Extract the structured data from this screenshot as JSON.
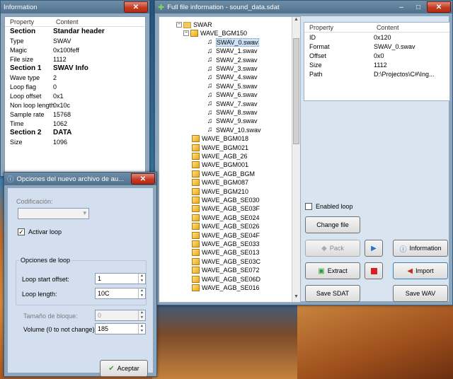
{
  "info_window": {
    "title": "Information",
    "close_icon": "close-icon",
    "columns": [
      "Property",
      "Content"
    ],
    "rows": [
      {
        "k": "Section",
        "v": "Standar header",
        "section": true
      },
      {
        "k": "Type",
        "v": "SWAV"
      },
      {
        "k": "Magic",
        "v": "0x100feff"
      },
      {
        "k": "File size",
        "v": "1112"
      },
      {
        "k": "Section 1",
        "v": "SWAV Info",
        "section": true
      },
      {
        "k": "Wave type",
        "v": "2"
      },
      {
        "k": "Loop flag",
        "v": "0"
      },
      {
        "k": "Loop offset",
        "v": "0x1"
      },
      {
        "k": "Non loop length",
        "v": "0x10c"
      },
      {
        "k": "Sample rate",
        "v": "15768"
      },
      {
        "k": "Time",
        "v": "1062"
      },
      {
        "k": "Section 2",
        "v": "DATA",
        "section": true
      },
      {
        "k": "Size",
        "v": "1096"
      }
    ]
  },
  "main_window": {
    "title": "Full file information - sound_data.sdat",
    "minimize": "–",
    "maximize": "□",
    "close": "✕",
    "tree": {
      "root": "SWAR",
      "expanded": "WAVE_BGM150",
      "children": [
        "SWAV_0.swav",
        "SWAV_1.swav",
        "SWAV_2.swav",
        "SWAV_3.swav",
        "SWAV_4.swav",
        "SWAV_5.swav",
        "SWAV_6.swav",
        "SWAV_7.swav",
        "SWAV_8.swav",
        "SWAV_9.swav",
        "SWAV_10.swav"
      ],
      "selected": "SWAV_0.swav",
      "siblings": [
        "WAVE_BGM018",
        "WAVE_BGM021",
        "WAVE_AGB_26",
        "WAVE_BGM001",
        "WAVE_AGB_BGM",
        "WAVE_BGM087",
        "WAVE_BGM210",
        "WAVE_AGB_SE030",
        "WAVE_AGB_SE03F",
        "WAVE_AGB_SE024",
        "WAVE_AGB_SE026",
        "WAVE_AGB_SE04F",
        "WAVE_AGB_SE033",
        "WAVE_AGB_SE013",
        "WAVE_AGB_SE03C",
        "WAVE_AGB_SE072",
        "WAVE_AGB_SE06D",
        "WAVE_AGB_SE016"
      ]
    },
    "props": {
      "columns": [
        "Property",
        "Content"
      ],
      "rows": [
        {
          "k": "ID",
          "v": "0x120"
        },
        {
          "k": "Format",
          "v": "SWAV_0.swav"
        },
        {
          "k": "Offset",
          "v": "0x0"
        },
        {
          "k": "Size",
          "v": "1112"
        },
        {
          "k": "Path",
          "v": "D:\\Projectos\\C#\\Ing..."
        }
      ]
    },
    "enabled_loop": "Enabled loop",
    "buttons": {
      "change_file": "Change file",
      "pack": "Pack",
      "information": "Information",
      "extract": "Extract",
      "import": "Import",
      "save_sdat": "Save SDAT",
      "save_wav": "Save WAV"
    }
  },
  "options_dialog": {
    "title": "Opciones del nuevo archivo de au...",
    "close": "✕",
    "codificacion_label": "Codificación:",
    "codificacion_value": "",
    "activar_loop": "Activar loop",
    "group_title": "Opciones de loop",
    "loop_start_label": "Loop start offset:",
    "loop_start_value": "1",
    "loop_length_label": "Loop length:",
    "loop_length_value": "10C",
    "bloque_label": "Tamaño de bloque:",
    "bloque_value": "0",
    "volume_label": "Volume (0 to not change):",
    "volume_value": "185",
    "accept": "Aceptar"
  }
}
